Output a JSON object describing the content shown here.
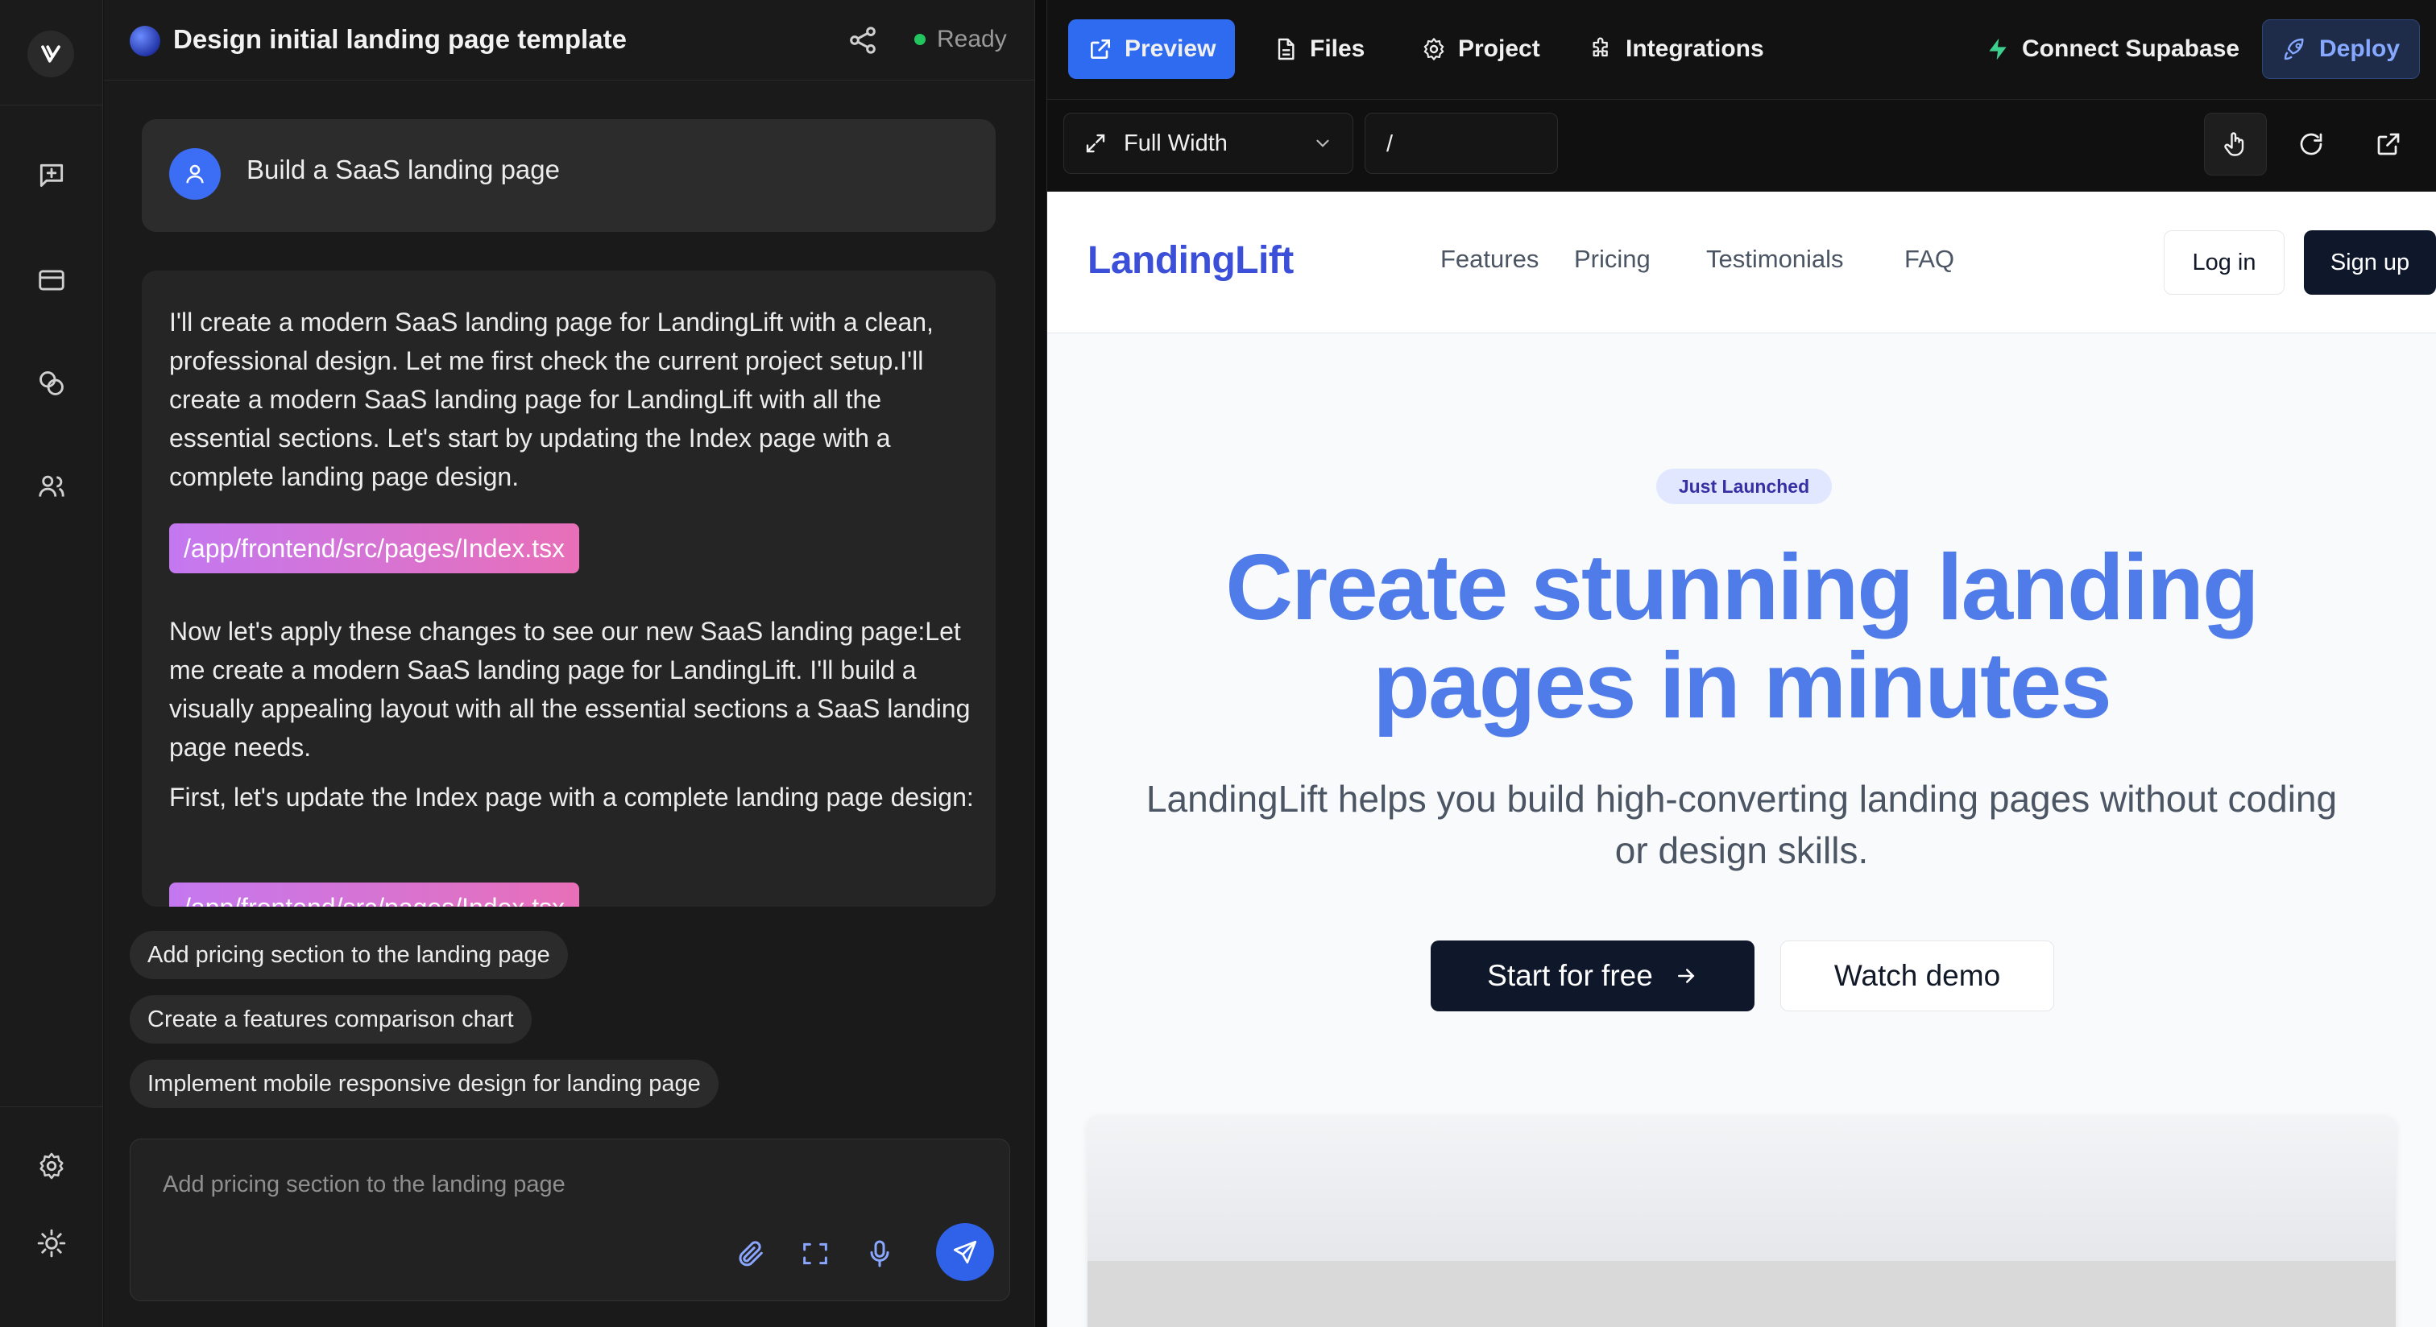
{
  "chat": {
    "title": "Design initial landing page template",
    "status": "Ready",
    "user_message": "Build a SaaS landing page",
    "assistant_paragraph_1": "I'll create a modern SaaS landing page for LandingLift with a clean, professional design. Let me first check the current project setup.I'll create a modern SaaS landing page for LandingLift with all the essential sections. Let's start by updating the Index page with a complete landing page design.",
    "file_chip_1": "/app/frontend/src/pages/Index.tsx",
    "assistant_paragraph_2": "Now let's apply these changes to see our new SaaS landing page:Let me create a modern SaaS landing page for LandingLift. I'll build a visually appealing layout with all the essential sections a SaaS landing page needs.",
    "assistant_paragraph_3": "First, let's update the Index page with a complete landing page design:",
    "file_chip_2": "/app/frontend/src/pages/Index.tsx",
    "suggestions": [
      "Add pricing section to the landing page",
      "Create a features comparison chart",
      "Implement mobile responsive design for landing page"
    ],
    "composer_placeholder": "Add pricing section to the landing page"
  },
  "toolbar": {
    "preview": "Preview",
    "files": "Files",
    "project": "Project",
    "integrations": "Integrations",
    "connect_supabase": "Connect Supabase",
    "deploy": "Deploy",
    "width_select": "Full Width",
    "path": "/"
  },
  "site": {
    "brand": "LandingLift",
    "nav": [
      "Features",
      "Pricing",
      "Testimonials",
      "FAQ"
    ],
    "login": "Log in",
    "signup": "Sign up",
    "badge": "Just Launched",
    "hero_title_line1": "Create stunning landing",
    "hero_title_line2": "pages in minutes",
    "hero_subtitle": "LandingLift helps you build high-converting landing pages without coding or design skills.",
    "cta_primary": "Start for free",
    "cta_secondary": "Watch demo"
  },
  "colors": {
    "accent": "#2f6bf0",
    "brand": "#3b4fd8",
    "hero_title": "#4f7ce8",
    "status_ready": "#22c55e"
  }
}
